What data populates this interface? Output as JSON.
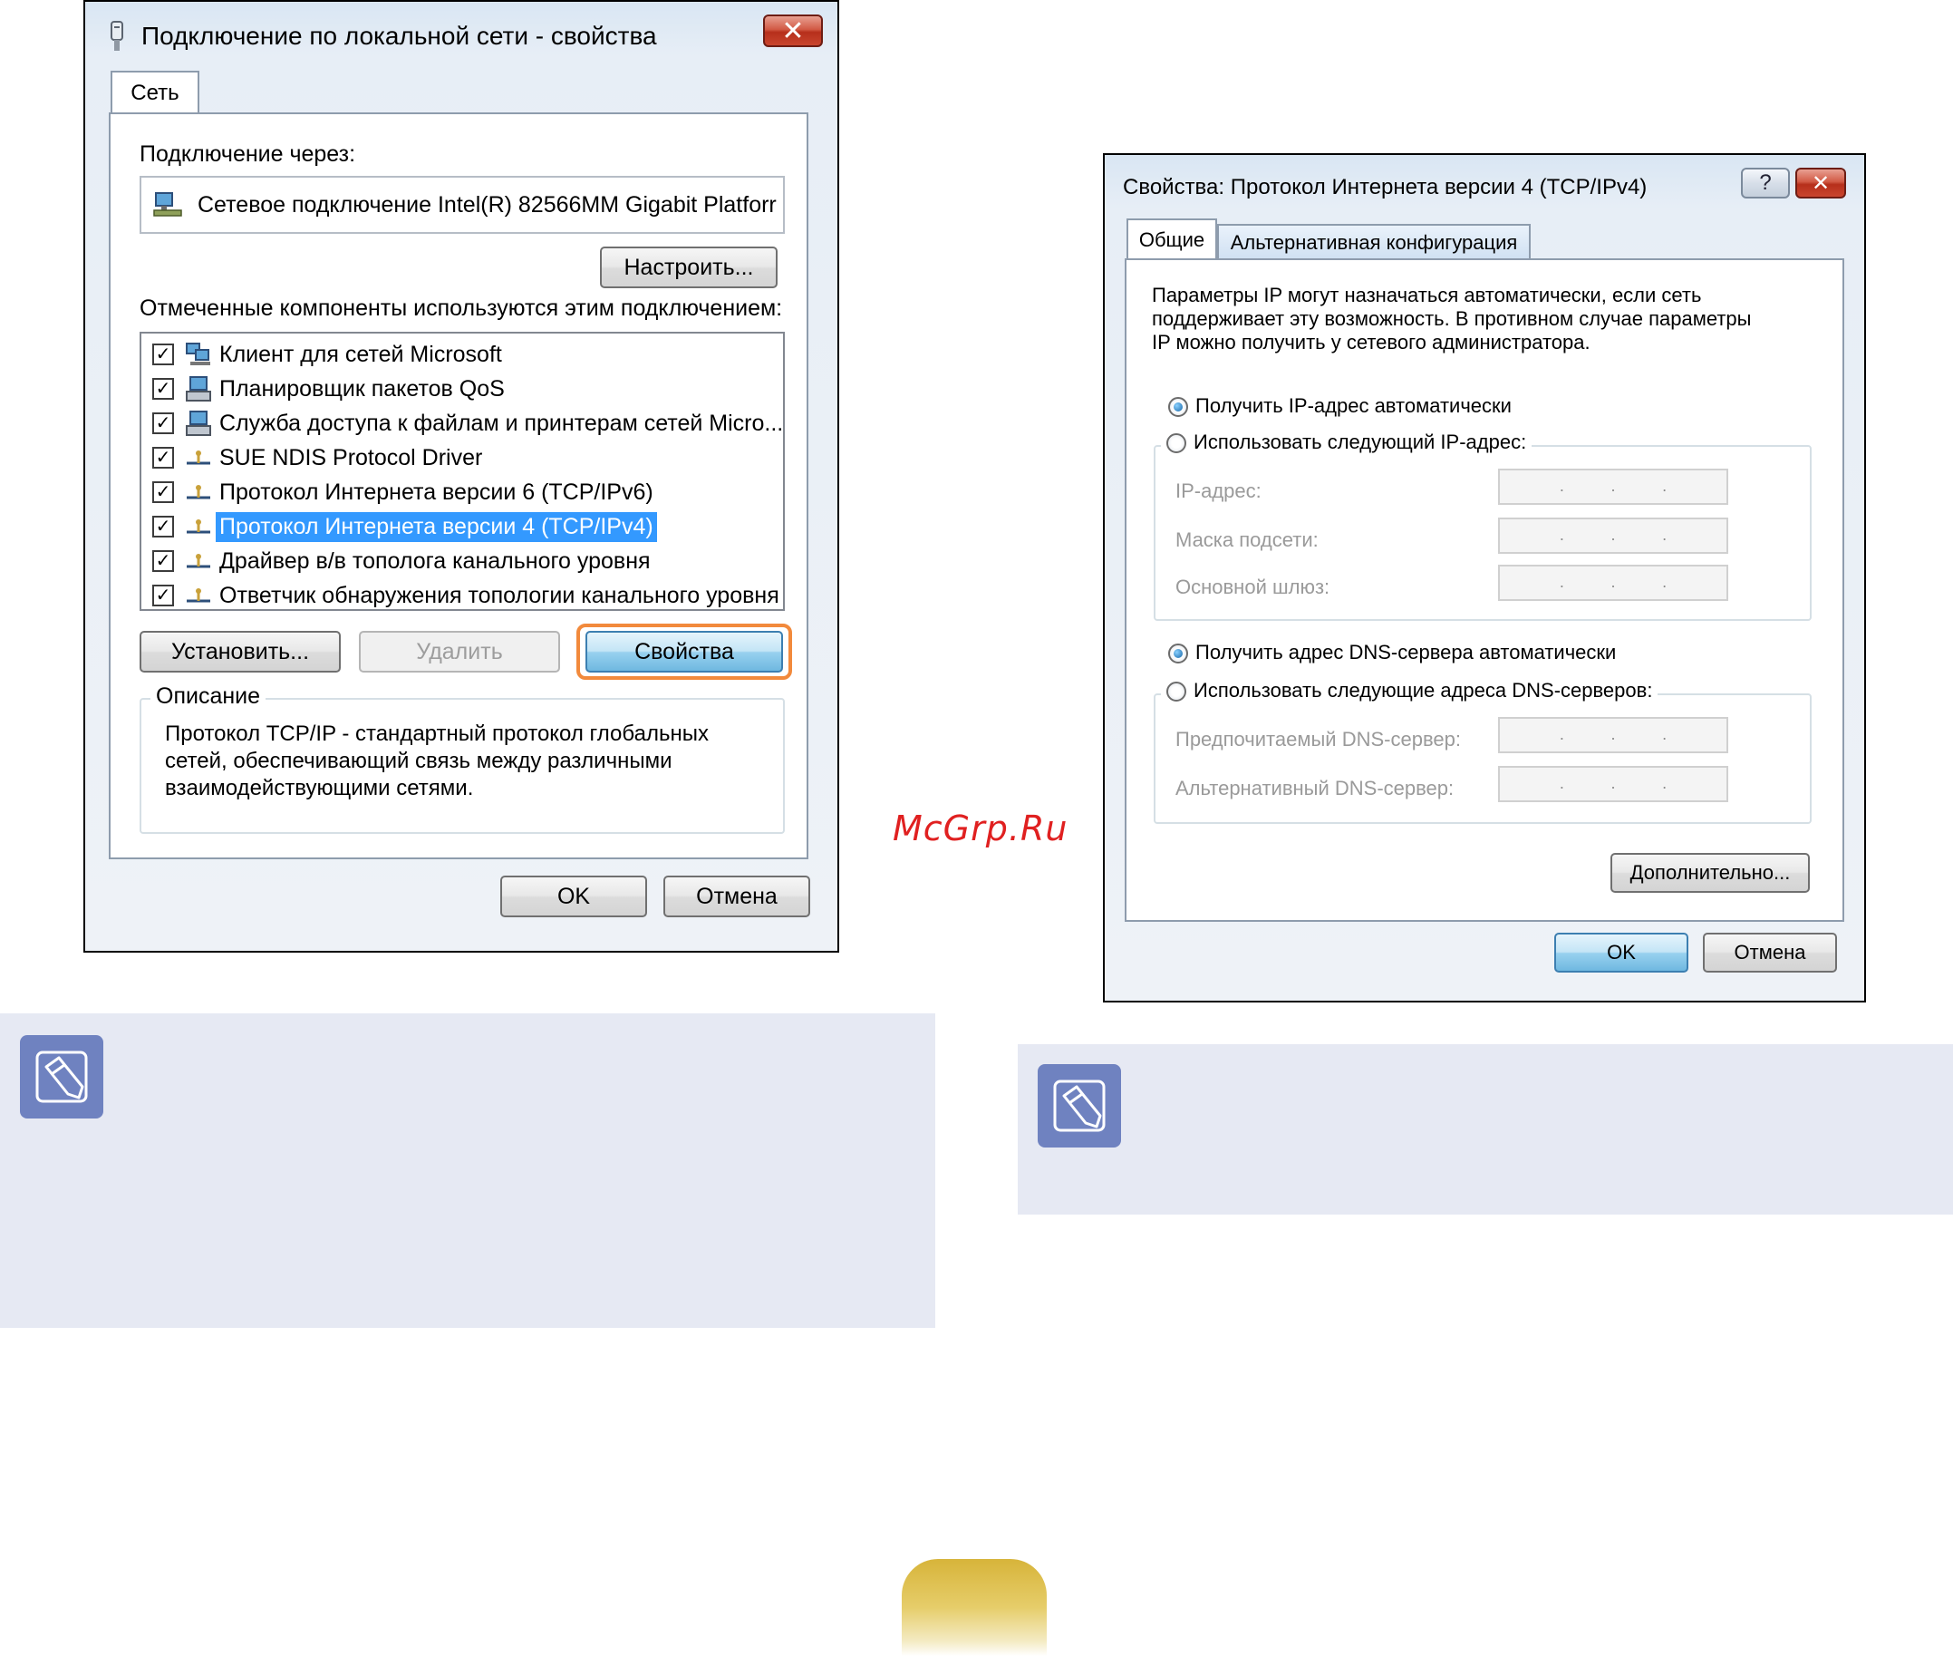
{
  "dialog1": {
    "title": "Подключение по локальной сети - свойства",
    "close_label": "✕",
    "tab": "Сеть",
    "connect_via_label": "Подключение через:",
    "adapter_name": "Сетевое подключение Intel(R) 82566MM Gigabit Platforr",
    "configure_label": "Настроить...",
    "components_label": "Отмеченные компоненты используются этим подключением:",
    "components": [
      "Клиент для сетей Microsoft",
      "Планировщик пакетов QoS",
      "Служба доступа к файлам и принтерам сетей Micro...",
      "SUE NDIS Protocol Driver",
      "Протокол Интернета версии 6 (TCP/IPv6)",
      "Протокол Интернета версии 4 (TCP/IPv4)",
      "Драйвер в/в тополога канального уровня",
      "Ответчик обнаружения топологии канального уровня"
    ],
    "install_label": "Установить...",
    "remove_label": "Удалить",
    "properties_label": "Свойства",
    "description_title": "Описание",
    "description_text_1": "Протокол TCP/IP - стандартный протокол глобальных",
    "description_text_2": "сетей, обеспечивающий связь между различными",
    "description_text_3": "взаимодействующими сетями.",
    "ok_label": "OK",
    "cancel_label": "Отмена",
    "highlight_color": "#f28a3c"
  },
  "dialog2": {
    "title": "Свойства: Протокол Интернета версии 4 (TCP/IPv4)",
    "help_label": "?",
    "close_label": "✕",
    "tab_general": "Общие",
    "tab_alt": "Альтернативная конфигурация",
    "intro_1": "Параметры IP могут назначаться автоматически, если сеть",
    "intro_2": "поддерживает эту возможность. В противном случае параметры",
    "intro_3": "IP можно получить у сетевого администратора.",
    "radio_ip_auto": "Получить IP-адрес автоматически",
    "radio_ip_manual": "Использовать следующий IP-адрес:",
    "ip_label": "IP-адрес:",
    "mask_label": "Маска подсети:",
    "gateway_label": "Основной шлюз:",
    "radio_dns_auto": "Получить адрес DNS-сервера автоматически",
    "radio_dns_manual": "Использовать следующие адреса DNS-серверов:",
    "dns_pref_label": "Предпочитаемый DNS-сервер:",
    "dns_alt_label": "Альтернативный DNS-сервер:",
    "advanced_label": "Дополнительно...",
    "ok_label": "OK",
    "cancel_label": "Отмена",
    "ip_dot": "."
  },
  "watermark": "McGrp.Ru"
}
